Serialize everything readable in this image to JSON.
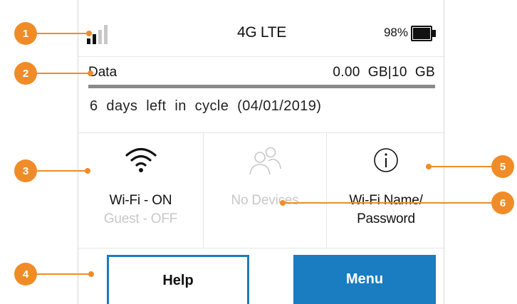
{
  "status_bar": {
    "network": "4G LTE",
    "battery_percent": "98%",
    "battery_level": 0.98,
    "signal_bars_active": 2,
    "signal_bars_total": 4
  },
  "data": {
    "label": "Data",
    "usage": "0.00  GB|10  GB",
    "usage_fraction": 0.0,
    "cycle": "6  days  left  in  cycle  (04/01/2019)"
  },
  "tiles": {
    "wifi": {
      "line1": "Wi-Fi - ON",
      "line2": "Guest - OFF",
      "icon": "wifi-icon"
    },
    "devices": {
      "line1": "No Devices",
      "icon": "people-icon"
    },
    "wifi_name": {
      "line1": "Wi-Fi Name/",
      "line2": "Password",
      "icon": "info-icon"
    }
  },
  "buttons": {
    "help": "Help",
    "menu": "Menu"
  },
  "callouts": [
    "1",
    "2",
    "3",
    "4",
    "5",
    "6"
  ],
  "colors": {
    "accent": "#1a7cc1",
    "callout": "#f08c28",
    "disabled_text": "#c8c8c8"
  }
}
